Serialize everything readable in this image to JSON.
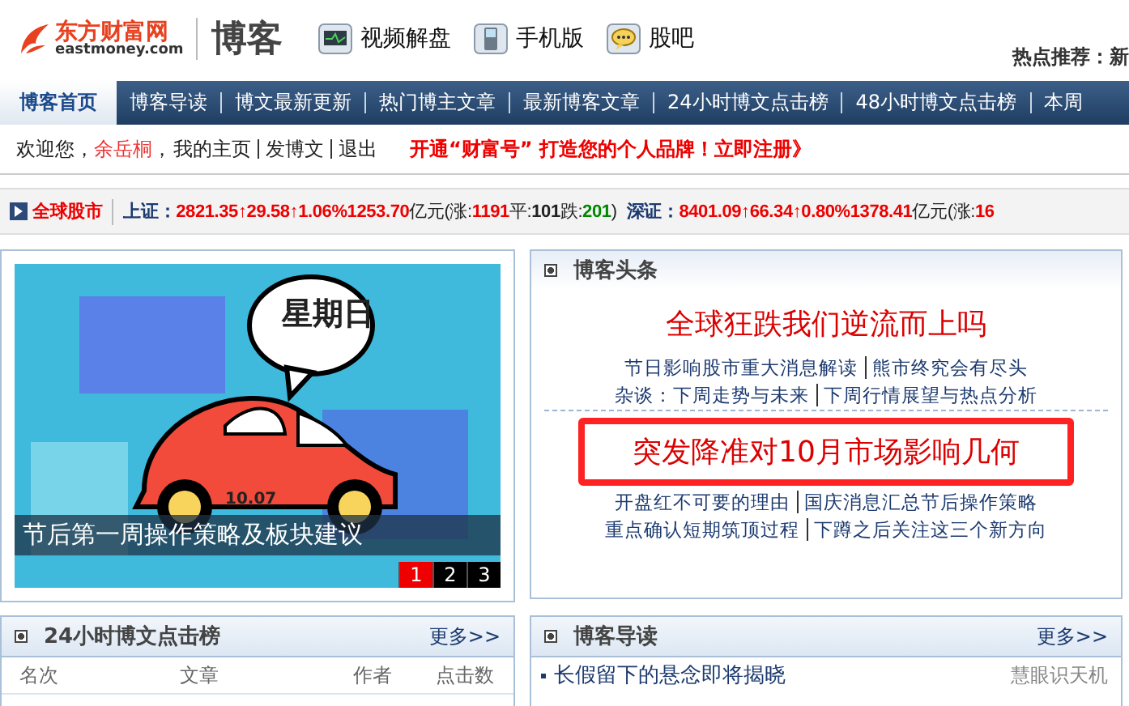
{
  "header": {
    "logo_cn": "东方财富网",
    "logo_en": "eastmoney.com",
    "section": "博客",
    "links": [
      {
        "kind": "video",
        "label": "视频解盘"
      },
      {
        "kind": "mobile",
        "label": "手机版"
      },
      {
        "kind": "chat",
        "label": "股吧"
      }
    ],
    "hot": "热点推荐：新"
  },
  "nav": [
    {
      "label": "博客首页",
      "selected": true
    },
    {
      "label": "博客导读",
      "selected": false
    },
    {
      "label": "博文最新更新",
      "selected": false
    },
    {
      "label": "热门博主文章",
      "selected": false
    },
    {
      "label": "最新博客文章",
      "selected": false
    },
    {
      "label": "24小时博文点击榜",
      "selected": false
    },
    {
      "label": "48小时博文点击榜",
      "selected": false
    },
    {
      "label": "本周",
      "selected": false
    }
  ],
  "welcome": {
    "greeting": "欢迎您，",
    "user": "余岳桐",
    "separator": "，",
    "links": [
      "我的主页",
      "发博文",
      "退出"
    ],
    "promo": "开通“财富号” 打造您的个人品牌！立即注册》"
  },
  "ticker": {
    "label": "全球股市",
    "items": [
      {
        "name": "上证：",
        "index": "2821.35↑29.58↑1.06%1253.70",
        "unit": "亿元(涨:",
        "up": "1191",
        "flat_label": "平:",
        "flat": "101",
        "down_label": "跌:",
        "down": "201",
        "close": ")"
      },
      {
        "name": "深证：",
        "index": "8401.09↑66.34↑0.80%1378.41",
        "unit": "亿元(涨:",
        "up": "16"
      }
    ]
  },
  "slideshow": {
    "bubble": "星期日",
    "date": "10.07",
    "caption": "节后第一周操作策略及板块建议",
    "pages": [
      {
        "label": "1",
        "selected": true
      },
      {
        "label": "2",
        "selected": false
      },
      {
        "label": "3",
        "selected": false
      }
    ]
  },
  "headlines": {
    "title": "博客头条",
    "groups": [
      {
        "headline": "全球狂跌我们逆流而上吗",
        "highlighted": false,
        "lines": [
          [
            "节日影响股市重大消息解读",
            "熊市终究会有尽头"
          ],
          [
            "杂谈：下周走势与未来",
            "下周行情展望与热点分析"
          ]
        ]
      },
      {
        "headline": "突发降准对10月市场影响几何",
        "highlighted": true,
        "lines": [
          [
            "开盘红不可要的理由",
            "国庆消息汇总节后操作策略"
          ],
          [
            "重点确认短期筑顶过程",
            "下蹲之后关注这三个新方向"
          ]
        ]
      }
    ]
  },
  "ranking": {
    "title": "24小时博文点击榜",
    "more": "更多>>",
    "columns": [
      "名次",
      "文章",
      "作者",
      "点击数"
    ]
  },
  "guide": {
    "title": "博客导读",
    "more": "更多>>",
    "items": [
      {
        "title": "长假留下的悬念即将揭晓",
        "author": "慧眼识天机"
      }
    ]
  }
}
